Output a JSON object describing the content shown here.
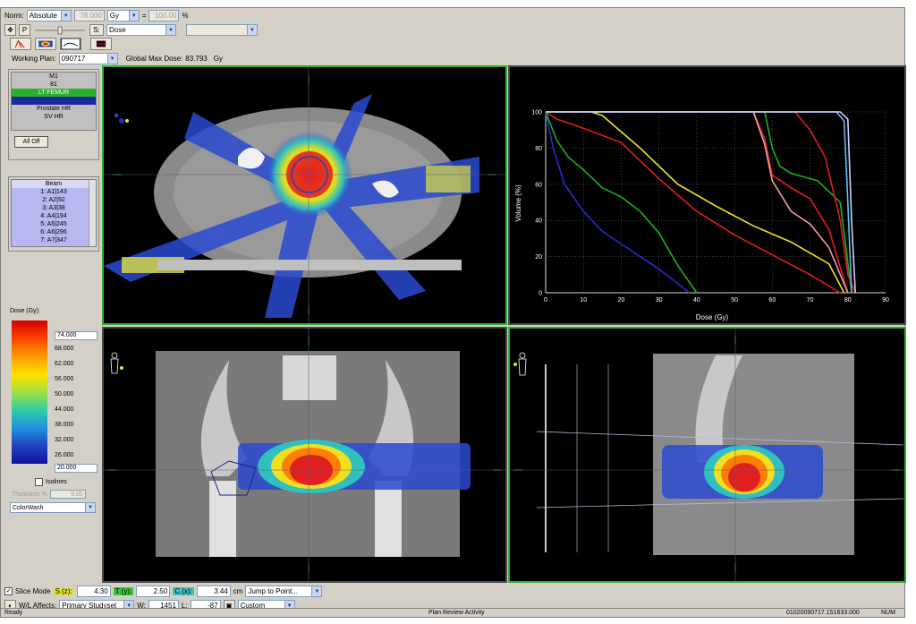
{
  "toolbar": {
    "norm_label": "Norm:",
    "norm_mode": "Absolute",
    "norm_value": "78.000",
    "norm_unit": "Gy",
    "norm_eq": "=",
    "norm_pct_value": "100.00",
    "norm_pct_unit": "%",
    "p_label": "P",
    "s_label": "S:",
    "s_value": "Dose",
    "working_plan_label": "Working Plan:",
    "working_plan_value": "090717",
    "global_max_label": "Global Max Dose:",
    "global_max_value": "83.793",
    "global_max_unit": "Gy"
  },
  "structures": {
    "items": [
      "M1",
      "81",
      "LT FEMUR",
      "",
      "Prostate HR",
      "SV HR"
    ],
    "all_off_label": "All Off"
  },
  "beams": {
    "header": "Beam",
    "items": [
      "1: A1|143",
      "2: A2|92",
      "3: A3|38",
      "4: A4|194",
      "5: A5|245",
      "6: A6|296",
      "7: A7|347"
    ]
  },
  "dose_scale": {
    "title": "Dose (Gy):",
    "max_value": "74.000",
    "ticks": [
      "68.000",
      "62.000",
      "56.000",
      "50.000",
      "44.000",
      "38.000",
      "32.000",
      "26.000"
    ],
    "min_value": "20.000",
    "isolines_label": "Isolines",
    "thickness_label": "Thickness %",
    "thickness_value": "5.00",
    "display_mode": "ColorWash"
  },
  "dvh_chart": {
    "chart_data": {
      "type": "line",
      "xlabel": "Dose (Gy)",
      "ylabel": "Volume (%)",
      "xlim": [
        0,
        90
      ],
      "ylim": [
        0,
        100
      ],
      "x_ticks": [
        "0",
        "10",
        "20",
        "30",
        "40",
        "50",
        "60",
        "70",
        "80",
        "90"
      ],
      "y_ticks": [
        "0",
        "20",
        "40",
        "60",
        "80",
        "100"
      ],
      "grid": true,
      "series": [
        {
          "color": "#2a2ad0",
          "x": [
            0,
            2,
            5,
            10,
            15,
            20,
            25,
            30,
            35,
            38
          ],
          "y": [
            100,
            80,
            60,
            45,
            34,
            27,
            20,
            13,
            5,
            0
          ]
        },
        {
          "color": "#1cb01c",
          "x": [
            0,
            3,
            6,
            10,
            15,
            20,
            25,
            30,
            35,
            40
          ],
          "y": [
            100,
            84,
            75,
            68,
            58,
            53,
            45,
            33,
            15,
            0
          ]
        },
        {
          "color": "#e01e1e",
          "x": [
            0,
            3,
            10,
            20,
            30,
            40,
            50,
            60,
            70,
            78
          ],
          "y": [
            100,
            96,
            91,
            83,
            63,
            45,
            32,
            21,
            10,
            0
          ]
        },
        {
          "color": "#f0e020",
          "x": [
            0,
            12,
            15,
            25,
            35,
            45,
            55,
            65,
            75,
            79
          ],
          "y": [
            100,
            100,
            98,
            80,
            60,
            48,
            37,
            28,
            16,
            0
          ]
        },
        {
          "color": "#e01e1e",
          "x": [
            0,
            55,
            58,
            60,
            65,
            70,
            75,
            80
          ],
          "y": [
            100,
            100,
            85,
            65,
            58,
            52,
            35,
            0
          ]
        },
        {
          "color": "#f0a0a0",
          "x": [
            0,
            55,
            58,
            60,
            65,
            70,
            75,
            80
          ],
          "y": [
            100,
            100,
            82,
            62,
            45,
            38,
            25,
            0
          ]
        },
        {
          "color": "#1cb01c",
          "x": [
            0,
            58,
            60,
            62,
            65,
            72,
            78,
            81
          ],
          "y": [
            100,
            100,
            80,
            70,
            66,
            62,
            50,
            0
          ]
        },
        {
          "color": "#e01e1e",
          "x": [
            0,
            66,
            70,
            74,
            78,
            80,
            82
          ],
          "y": [
            100,
            100,
            90,
            75,
            40,
            10,
            0
          ]
        },
        {
          "color": "#60c0f0",
          "x": [
            0,
            77,
            79,
            80,
            81
          ],
          "y": [
            100,
            100,
            95,
            50,
            0
          ]
        },
        {
          "color": "#d0d0ff",
          "x": [
            0,
            78,
            80,
            81,
            82
          ],
          "y": [
            100,
            100,
            96,
            40,
            0
          ]
        }
      ]
    }
  },
  "bottom_bar": {
    "slice_mode_label": "Slice Mode",
    "s_label": "S (z):",
    "s_value": "4.30",
    "t_label": "T (y):",
    "t_value": "2.50",
    "c_label": "C (x):",
    "c_value": "3.44",
    "unit": "cm",
    "jump_label": "Jump to Point...",
    "wl_affects_label": "W/L Affects:",
    "wl_affects_value": "Primary Studyset",
    "w_label": "W:",
    "w_value": "1451",
    "l_label": "L:",
    "l_value": "-87",
    "preset_value": "Custom"
  },
  "status": {
    "left": "Ready",
    "center": "Plan Review Activity",
    "right": "01020090717.151633.000",
    "mode": "NUM"
  },
  "colors": {
    "active_border": "#2bb02b",
    "selected_structure": "#2bb02b",
    "beam_list_bg": "#b8b8f0"
  }
}
